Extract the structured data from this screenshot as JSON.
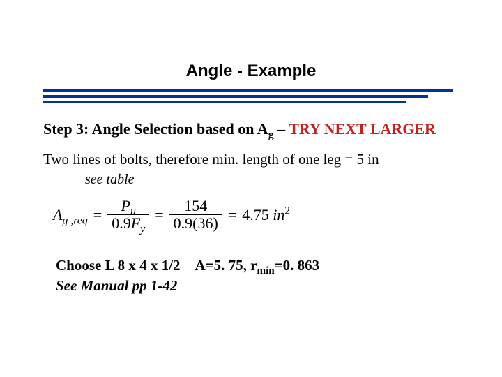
{
  "title": "Angle - Example",
  "step3": {
    "prefix": "Step 3: Angle Selection based on A",
    "sub": "g",
    "dash": "– ",
    "try_next": "TRY NEXT LARGER"
  },
  "two_lines": "Two lines of bolts, therefore min. length of one leg = 5 in",
  "see_table": "see table",
  "eq": {
    "lhs_A": "A",
    "lhs_sub": "g ,req",
    "eq1": "=",
    "frac1_num_P": "P",
    "frac1_num_sub": "u",
    "frac1_den_09": "0.9",
    "frac1_den_F": "F",
    "frac1_den_sub": "y",
    "eq2": "=",
    "frac2_num": "154",
    "frac2_den": "0.9(36)",
    "eq3": "=",
    "result_val": "4.75",
    "result_unit_in": "in",
    "result_unit_sup": "2"
  },
  "choose": {
    "text1": "Choose L 8 x 4 x 1/2 A=5. 75, r",
    "sub": "min",
    "text2": "=0. 863"
  },
  "see_manual": "See Manual pp 1-42"
}
